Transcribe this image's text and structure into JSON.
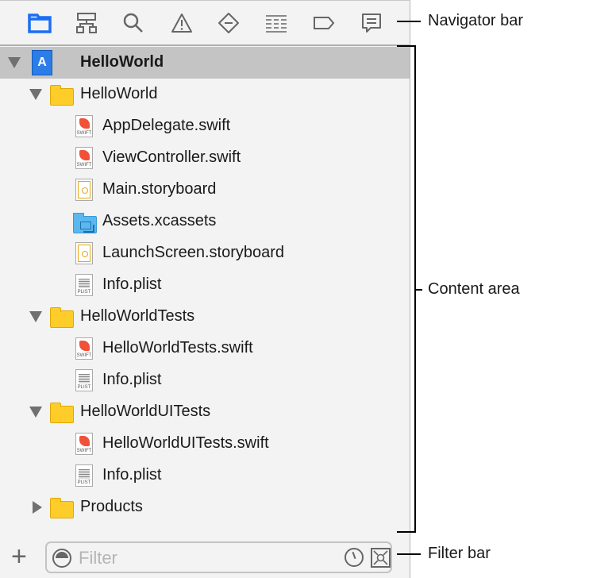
{
  "navigator": {
    "icons": [
      "folder-icon",
      "hierarchy-icon",
      "search-icon",
      "warning-icon",
      "breakpoint-diamond-icon",
      "report-list-icon",
      "tag-icon",
      "comment-icon"
    ],
    "active_index": 0,
    "accent": "#1a6ef5"
  },
  "tree": [
    {
      "label": "HelloWorld",
      "level": 0,
      "kind": "project",
      "disclosure": "down",
      "selected": true
    },
    {
      "label": "HelloWorld",
      "level": 1,
      "kind": "folder",
      "disclosure": "down"
    },
    {
      "label": "AppDelegate.swift",
      "level": 2,
      "kind": "swift"
    },
    {
      "label": "ViewController.swift",
      "level": 2,
      "kind": "swift"
    },
    {
      "label": "Main.storyboard",
      "level": 2,
      "kind": "storyboard"
    },
    {
      "label": "Assets.xcassets",
      "level": 2,
      "kind": "assets"
    },
    {
      "label": "LaunchScreen.storyboard",
      "level": 2,
      "kind": "storyboard"
    },
    {
      "label": "Info.plist",
      "level": 2,
      "kind": "plist"
    },
    {
      "label": "HelloWorldTests",
      "level": 1,
      "kind": "folder",
      "disclosure": "down"
    },
    {
      "label": "HelloWorldTests.swift",
      "level": 2,
      "kind": "swift"
    },
    {
      "label": "Info.plist",
      "level": 2,
      "kind": "plist"
    },
    {
      "label": "HelloWorldUITests",
      "level": 1,
      "kind": "folder",
      "disclosure": "down"
    },
    {
      "label": "HelloWorldUITests.swift",
      "level": 2,
      "kind": "swift"
    },
    {
      "label": "Info.plist",
      "level": 2,
      "kind": "plist"
    },
    {
      "label": "Products",
      "level": 1,
      "kind": "folder",
      "disclosure": "right"
    }
  ],
  "file_badges": {
    "swift": "SWIFT",
    "plist": "PLIST"
  },
  "filter": {
    "placeholder": "Filter",
    "add_label": "+"
  },
  "annotations": {
    "navigator": "Navigator bar",
    "content": "Content area",
    "filter": "Filter bar"
  }
}
